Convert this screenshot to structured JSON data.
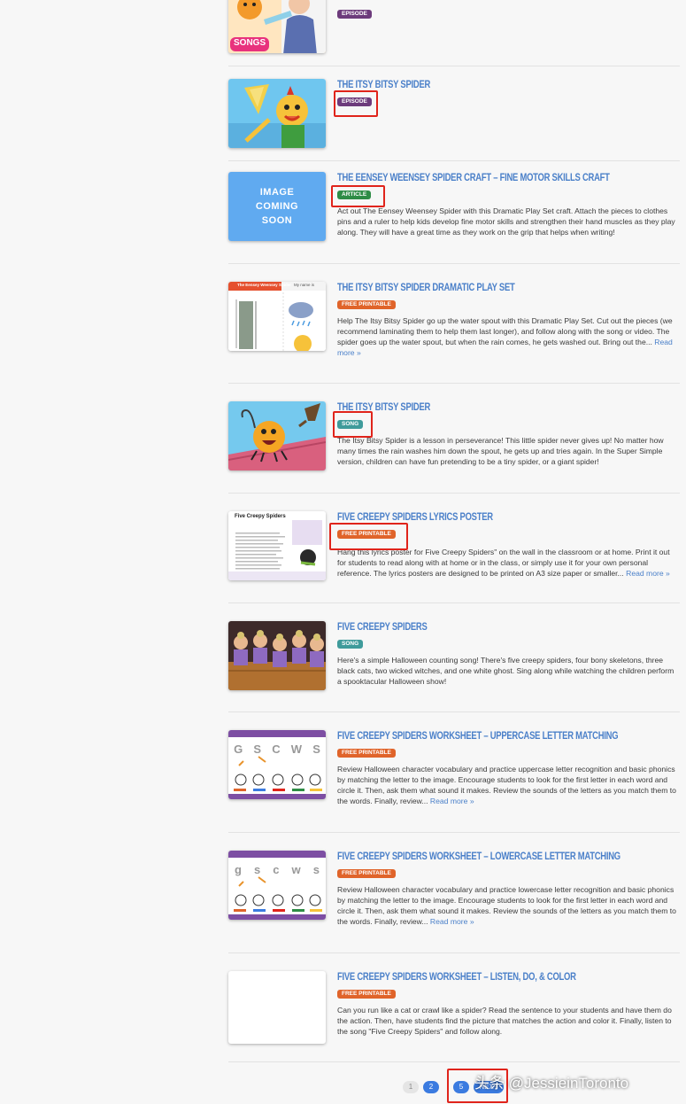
{
  "items": [
    {
      "title": "",
      "badge": "EPISODE",
      "thumb_label": "SONGS"
    },
    {
      "title": "THE ITSY BITSY SPIDER",
      "badge": "EPISODE"
    },
    {
      "title": "THE EENSEY WEENSEY SPIDER CRAFT – FINE MOTOR SKILLS CRAFT",
      "badge": "ARTICLE",
      "desc": "Act out The Eensey Weensey Spider with this Dramatic Play Set craft. Attach the pieces to clothes pins and a ruler to help kids develop fine motor skills and strengthen their hand muscles as they play along. They will have a great time as they work on the grip that helps when writing!",
      "thumb_lines": [
        "IMAGE",
        "COMING",
        "SOON"
      ]
    },
    {
      "title": "THE ITSY BITSY SPIDER DRAMATIC PLAY SET",
      "badge": "FREE PRINTABLE",
      "desc": "Help The Itsy Bitsy Spider go up the water spout with this Dramatic Play Set. Cut out the pieces (we recommend laminating them to help them last longer), and follow along with the song or video. The spider goes up the water spout, but when the rain comes, he gets washed out. Bring out the...",
      "more": "Read more »",
      "thumb_title": "The Eensey Weensey Spider",
      "thumb_title2": "My name is"
    },
    {
      "title": "THE ITSY BITSY SPIDER",
      "badge": "SONG",
      "desc": "The Itsy Bitsy Spider is a lesson in perseverance! This little spider never gives up! No matter how many times the rain washes him down the spout, he gets up and tries again. In the Super Simple version, children can have fun pretending to be a tiny spider, or a giant spider!"
    },
    {
      "title": "FIVE CREEPY SPIDERS LYRICS POSTER",
      "badge": "FREE PRINTABLE",
      "desc": "Hang this lyrics poster for Five Creepy Spiders\" on the wall in the classroom or at home. Print it out for students to read along with at home or in the class, or simply use it for your own personal reference. The lyrics posters are designed to be printed on A3 size paper or smaller...",
      "more": "Read more »",
      "thumb_title": "Five Creepy Spiders"
    },
    {
      "title": "FIVE CREEPY SPIDERS",
      "badge": "SONG",
      "desc": "Here's a simple Halloween counting song! There's five creepy spiders, four bony skeletons, three black cats, two wicked witches, and one white ghost. Sing along while watching the children perform a spooktacular Halloween show!"
    },
    {
      "title": "FIVE CREEPY SPIDERS WORKSHEET – UPPERCASE LETTER MATCHING",
      "badge": "FREE PRINTABLE",
      "desc": "Review Halloween character vocabulary and practice uppercase letter recognition and basic phonics by matching the letter to the image. Encourage students to look for the first letter in each word and circle it. Then, ask them what sound it makes. Review the sounds of the letters as you match them to the words. Finally, review...",
      "more": "Read more »",
      "thumb_letters": [
        "G",
        "S",
        "C",
        "W",
        "S"
      ]
    },
    {
      "title": "FIVE CREEPY SPIDERS WORKSHEET – LOWERCASE LETTER MATCHING",
      "badge": "FREE PRINTABLE",
      "desc": "Review Halloween character vocabulary and practice lowercase letter recognition and basic phonics by matching the letter to the image. Encourage students to look for the first letter in each word and circle it. Then, ask them what sound it makes. Review the sounds of the letters as you match them to the words. Finally, review...",
      "more": "Read more »",
      "thumb_letters": [
        "g",
        "s",
        "c",
        "w",
        "s"
      ]
    },
    {
      "title": "FIVE CREEPY SPIDERS WORKSHEET – LISTEN, DO, & COLOR",
      "badge": "FREE PRINTABLE",
      "desc": "Can you run like a cat or crawl like a spider? Read the sentence to your students and have them do the action. Then, have students find the picture that matches the action and color it. Finally, listen to the song \"Five Creepy Spiders\" and follow along."
    }
  ],
  "pagination": {
    "pages": [
      "1",
      "2",
      "5"
    ],
    "next": "NEXT",
    "current": "2"
  },
  "watermark": "头条 @JessieinToronto",
  "colors": {
    "title": "#4b80c9",
    "episode": "#6d3b7c",
    "article": "#2e8c46",
    "free_printable": "#e0642a",
    "song": "#3f9b9b",
    "highlight": "#e0241b"
  }
}
